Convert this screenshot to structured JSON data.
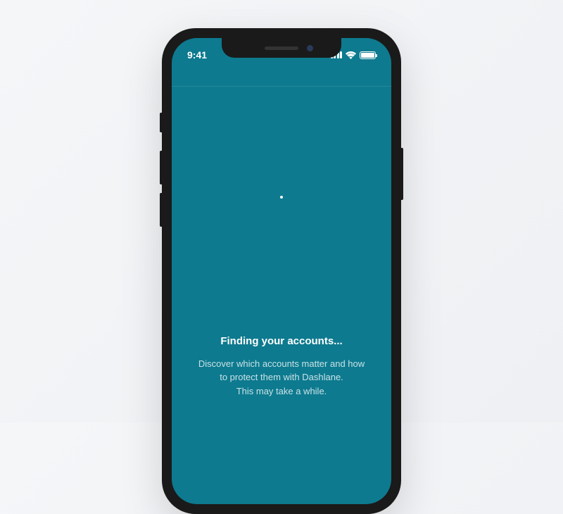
{
  "status_bar": {
    "time": "9:41"
  },
  "screen": {
    "title": "Finding your accounts...",
    "subtitle_line1": "Discover which accounts matter and how",
    "subtitle_line2": "to protect them with Dashlane.",
    "subtitle_line3": "This may take a while."
  },
  "colors": {
    "screen_bg": "#0d7a8f",
    "frame": "#1a1a1a"
  }
}
